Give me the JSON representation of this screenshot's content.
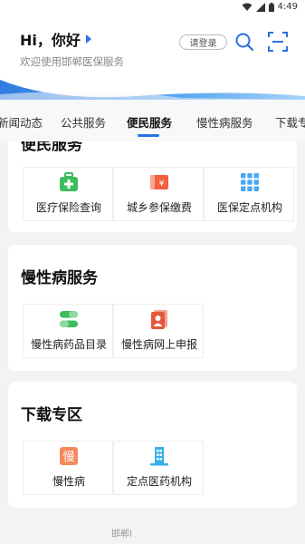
{
  "status_bar": {
    "time": "4:49",
    "icons": [
      "wifi-icon",
      "signal-icon",
      "battery-icon"
    ]
  },
  "header": {
    "greeting": "Hi，你好",
    "subtitle": "欢迎使用邯郸医保服务",
    "login_label": "请登录",
    "search_icon": "search-icon",
    "scan_icon": "scan-icon"
  },
  "tabs": [
    {
      "label": "新闻动态",
      "active": false
    },
    {
      "label": "公共服务",
      "active": false
    },
    {
      "label": "便民服务",
      "active": true
    },
    {
      "label": "慢性病服务",
      "active": false
    },
    {
      "label": "下载专",
      "active": false
    }
  ],
  "sections": [
    {
      "title": "便民服务",
      "items": [
        {
          "label": "医疗保险查询",
          "icon": "medical-kit-icon",
          "color": "#3dbd5d"
        },
        {
          "label": "城乡参保缴费",
          "icon": "payment-icon",
          "color": "#f2603f"
        },
        {
          "label": "医保定点机构",
          "icon": "grid-icon",
          "color": "#4aa8f0"
        }
      ]
    },
    {
      "title": "慢性病服务",
      "items": [
        {
          "label": "慢性病药品目录",
          "icon": "pill-icon",
          "color": "#3dbd5d"
        },
        {
          "label": "慢性病网上申报",
          "icon": "document-icon",
          "color": "#e4583e"
        }
      ]
    },
    {
      "title": "下载专区",
      "items": [
        {
          "label": "慢性病",
          "icon": "chronic-icon",
          "icon_text": "慢",
          "color": "#f4895c"
        },
        {
          "label": "定点医药机构",
          "icon": "building-icon",
          "color": "#35b1e8"
        }
      ]
    }
  ],
  "footer": {
    "text": "邯郸I"
  },
  "colors": {
    "accent": "#2a6fe6",
    "background": "#f2f3f5"
  }
}
